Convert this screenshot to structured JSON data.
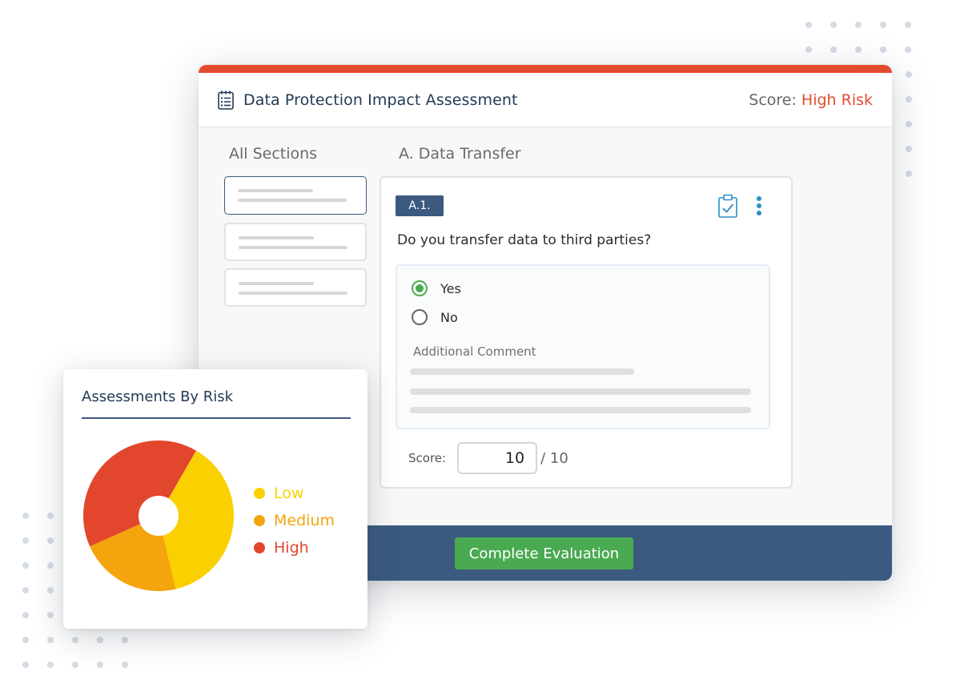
{
  "header": {
    "title": "Data Protection Impact Assessment",
    "score_label": "Score:",
    "score_value": "High Risk"
  },
  "sidebar": {
    "heading": "All Sections"
  },
  "main": {
    "section_heading": "A. Data Transfer",
    "question": {
      "badge": "A.1.",
      "text": "Do you transfer data to third parties?",
      "options": [
        {
          "label": "Yes",
          "checked": true
        },
        {
          "label": "No",
          "checked": false
        }
      ],
      "comment_label": "Additional Comment",
      "score_label": "Score:",
      "score_value": "10",
      "score_max": "/ 10"
    }
  },
  "footer": {
    "complete_label": "Complete Evaluation"
  },
  "risk_card": {
    "title": "Assessments By Risk"
  },
  "chart_data": {
    "type": "pie",
    "title": "Assessments By Risk",
    "series": [
      {
        "name": "Low",
        "value": 38,
        "color": "#fad000"
      },
      {
        "name": "Medium",
        "value": 22,
        "color": "#f4a40c"
      },
      {
        "name": "High",
        "value": 40,
        "color": "#e2472d"
      }
    ],
    "legend": "right"
  },
  "colors": {
    "accent_red": "#e34b2f",
    "navy": "#3c5a80",
    "green": "#4aaa52"
  }
}
